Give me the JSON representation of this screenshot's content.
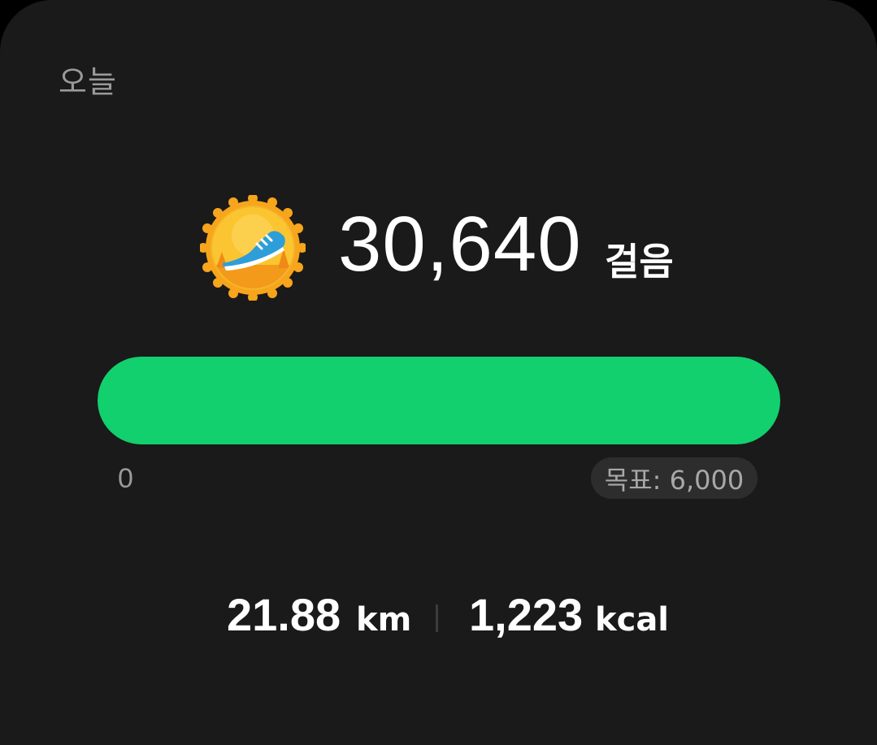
{
  "header": {
    "title": "오늘"
  },
  "steps": {
    "value": "30,640",
    "unit": "걸음",
    "badge_icon": "running-shoe-badge-icon"
  },
  "progress": {
    "min_label": "0",
    "goal_label": "목표: 6,000",
    "current": 30640,
    "goal": 6000,
    "fill_fraction": 1.0,
    "fill_color": "#12d06e"
  },
  "stats": {
    "distance_value": "21.88",
    "distance_unit": "km",
    "calories_value": "1,223",
    "calories_unit": "kcal"
  },
  "colors": {
    "background": "#1a1a1a",
    "accent": "#12d06e",
    "badge_orange": "#f7a51c"
  }
}
